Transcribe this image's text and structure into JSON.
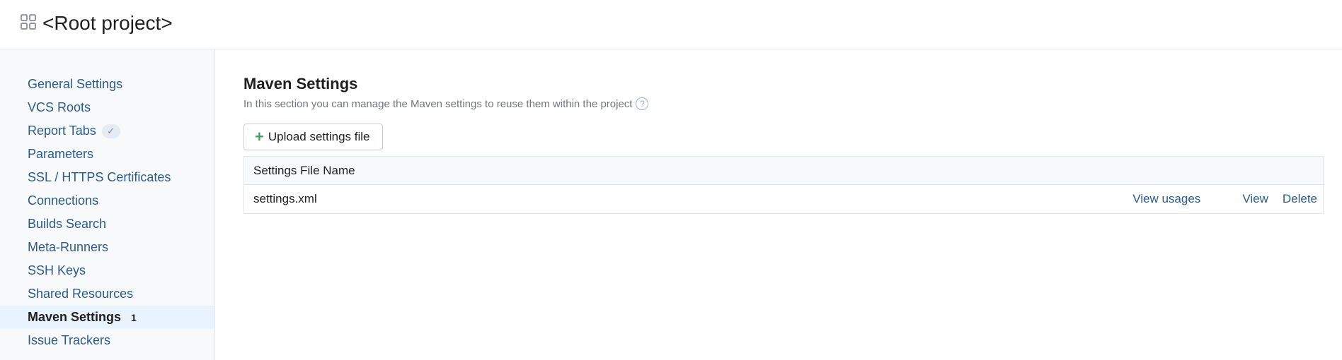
{
  "header": {
    "title": "<Root project>",
    "icon": "project-grid-icon"
  },
  "sidebar": {
    "items": [
      {
        "label": "General Settings"
      },
      {
        "label": "VCS Roots"
      },
      {
        "label": "Report Tabs",
        "badge_icon": "checkmark-icon"
      },
      {
        "label": "Parameters"
      },
      {
        "label": "SSL / HTTPS Certificates"
      },
      {
        "label": "Connections"
      },
      {
        "label": "Builds Search"
      },
      {
        "label": "Meta-Runners"
      },
      {
        "label": "SSH Keys"
      },
      {
        "label": "Shared Resources"
      },
      {
        "label": "Maven Settings",
        "count": "1",
        "active": true
      },
      {
        "label": "Issue Trackers"
      }
    ]
  },
  "main": {
    "title": "Maven Settings",
    "description": "In this section you can manage the Maven settings to reuse them within the project",
    "upload_button": "Upload settings file",
    "table": {
      "header": "Settings File Name",
      "rows": [
        {
          "file_name": "settings.xml",
          "actions": [
            "View usages",
            "View",
            "Delete"
          ]
        }
      ]
    }
  },
  "colors": {
    "link": "#2b5b8c",
    "active_bg": "#e8f3fd",
    "plus": "#3fa45b",
    "sidebar_bg": "#f7f9fb"
  }
}
